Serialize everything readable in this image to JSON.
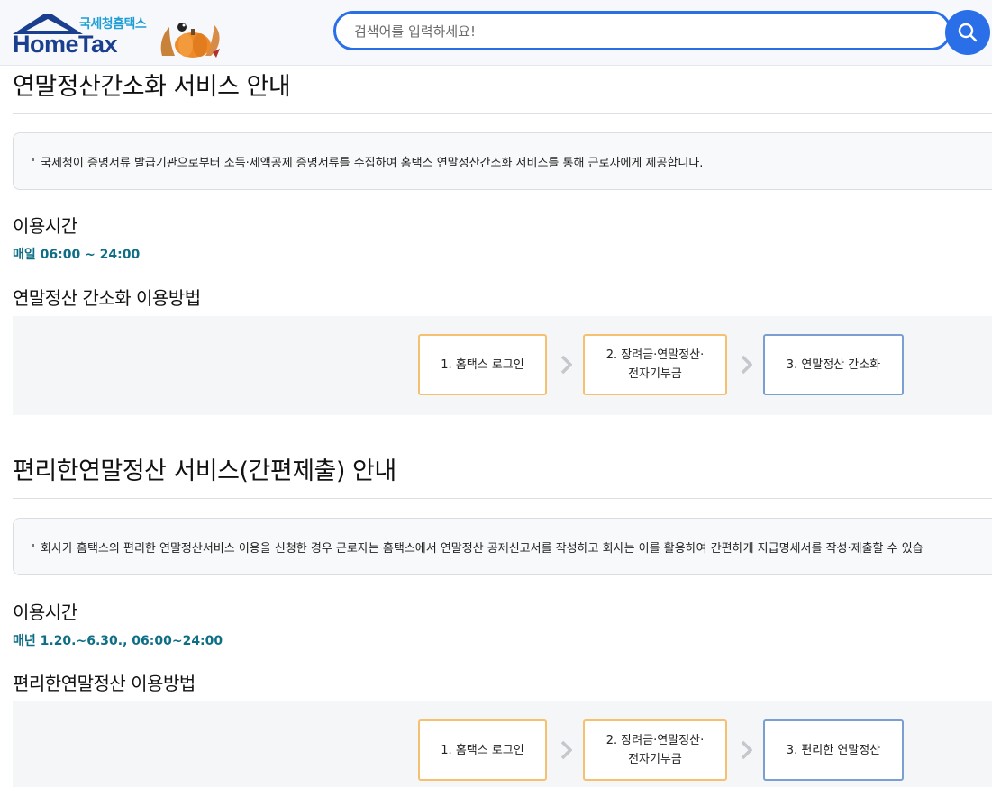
{
  "header": {
    "logo_sub": "국세청홈택스",
    "logo_main": "HomeTax",
    "search_placeholder": "검색어를 입력하세요!"
  },
  "section1": {
    "title": "연말정산간소화 서비스 안내",
    "notice": "국세청이 증명서류 발급기관으로부터 소득·세액공제 증명서류를 수집하여 홈택스 연말정산간소화 서비스를 통해 근로자에게 제공합니다.",
    "hours_title": "이용시간",
    "hours": "매일 06:00 ~ 24:00",
    "method_title": "연말정산 간소화 이용방법",
    "steps": [
      "1. 홈택스 로그인",
      "2. 장려금·연말정산·\n전자기부금",
      "3. 연말정산 간소화"
    ]
  },
  "section2": {
    "title": "편리한연말정산 서비스(간편제출) 안내",
    "notice": "회사가 홈택스의 편리한 연말정산서비스 이용을 신청한 경우 근로자는 홈택스에서 연말정산 공제신고서를 작성하고 회사는 이를 활용하여 간편하게 지급명세서를 작성·제출할 수 있습",
    "hours_title": "이용시간",
    "hours": "매년 1.20.~6.30., 06:00~24:00",
    "method_title": "편리한연말정산 이용방법",
    "steps": [
      "1. 홈택스 로그인",
      "2. 장려금·연말정산·\n전자기부금",
      "3. 편리한 연말정산"
    ]
  },
  "colors": {
    "accent": "#2a6ee8",
    "hours": "#0d6e86",
    "step_yellow": "#f5c070",
    "step_blue": "#7b9fd0"
  }
}
